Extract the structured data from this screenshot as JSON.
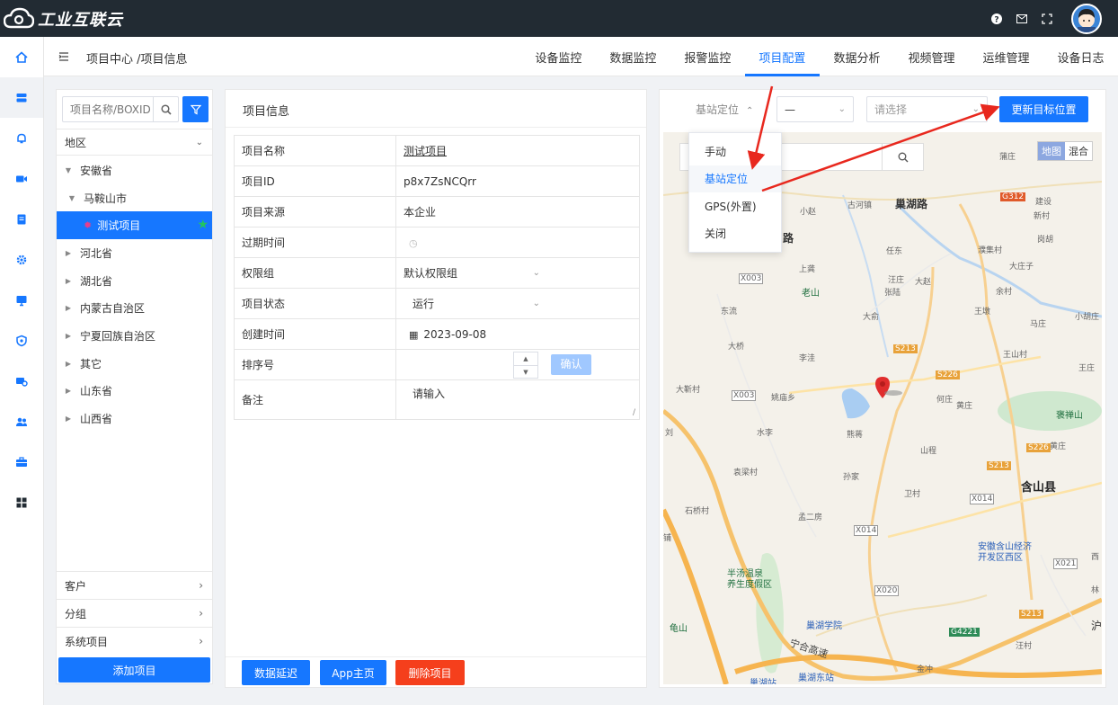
{
  "app": {
    "logo_text": "工业互联云"
  },
  "breadcrumb": "项目中心 /项目信息",
  "tabs": [
    {
      "label": "设备监控",
      "active": false
    },
    {
      "label": "数据监控",
      "active": false
    },
    {
      "label": "报警监控",
      "active": false
    },
    {
      "label": "项目配置",
      "active": true
    },
    {
      "label": "数据分析",
      "active": false
    },
    {
      "label": "视频管理",
      "active": false
    },
    {
      "label": "运维管理",
      "active": false
    },
    {
      "label": "设备日志",
      "active": false
    }
  ],
  "left": {
    "search_placeholder": "项目名称/BOXID",
    "region_label": "地区",
    "tree": [
      {
        "label": "安徽省",
        "level": 0,
        "expanded": true
      },
      {
        "label": "马鞍山市",
        "level": 1,
        "expanded": true
      },
      {
        "label": "测试项目",
        "level": 2,
        "active": true
      },
      {
        "label": "河北省",
        "level": 0
      },
      {
        "label": "湖北省",
        "level": 0
      },
      {
        "label": "内蒙古自治区",
        "level": 0
      },
      {
        "label": "宁夏回族自治区",
        "level": 0
      },
      {
        "label": "其它",
        "level": 0
      },
      {
        "label": "山东省",
        "level": 0
      },
      {
        "label": "山西省",
        "level": 0
      }
    ],
    "accordions": [
      "客户",
      "分组",
      "系统项目"
    ],
    "add_button": "添加项目"
  },
  "info": {
    "title": "项目信息",
    "rows": {
      "name_label": "项目名称",
      "name_value": "测试项目",
      "id_label": "项目ID",
      "id_value": "p8x7ZsNCQrr",
      "source_label": "项目来源",
      "source_value": "本企业",
      "expire_label": "过期时间",
      "perm_label": "权限组",
      "perm_value": "默认权限组",
      "status_label": "项目状态",
      "status_value": "运行",
      "created_label": "创建时间",
      "created_value": "2023-09-08",
      "sort_label": "排序号",
      "confirm": "确认",
      "remark_label": "备注",
      "remark_placeholder": "请输入"
    },
    "buttons": {
      "delay": "数据延迟",
      "app_home": "App主页",
      "delete": "删除项目"
    }
  },
  "map_panel": {
    "locate_mode": "基站定位",
    "select1": "—",
    "select2_placeholder": "请选择",
    "update_button": "更新目标位置",
    "toggle": {
      "map": "地图",
      "hybrid": "混合"
    },
    "dropdown": [
      {
        "label": "手动",
        "active": false
      },
      {
        "label": "基站定位",
        "active": true
      },
      {
        "label": "GPS(外置)",
        "active": false
      },
      {
        "label": "关闭",
        "active": false
      }
    ]
  },
  "map_labels": {
    "chaohu_road": "巢湖路",
    "road_frag": "路",
    "hanshan": "含山县",
    "laoshan": "老山",
    "taoshan": "褒禅山",
    "bantang": "半汤温泉",
    "bantang2": "养生度假区",
    "chaohu_college": "巢湖学院",
    "chaohu_east": "巢湖东站",
    "chaohu_station": "巢湖站",
    "kaifa": "安徽含山经济",
    "kaifa2": "开发区西区",
    "guishan": "龟山",
    "ninghe": "宁合高速",
    "guhe": "古河镇",
    "xiaozhao": "小赵",
    "renzhuang": "任东",
    "shangzhuang": "上龚",
    "dachen": "大俞",
    "wangqiao": "王墩",
    "daqiao": "大桥",
    "dongliu": "东流",
    "lizhuang": "李洼",
    "yaomiao": "姚庙乡",
    "dahuan": "大靳村",
    "shuili": "水李",
    "xiongjian": "熊蒋",
    "shancheng": "山程",
    "sunjia": "孙家",
    "weicun": "卫村",
    "yuan": "袁梁村",
    "shijiao": "石桥村",
    "mengerfang": "孟二房",
    "huangzhuang": "黄庄",
    "huangzhuang2": "黄庄",
    "hezhuang": "何庄",
    "wangshan": "王山村",
    "wangzhuang": "王庄",
    "yucun": "余村",
    "dakou": "大庄子",
    "machuang": "马庄",
    "xiaohu": "小胡庄",
    "jianshe": "建设",
    "xincun": "新村",
    "gangyu": "岗胡",
    "liji": "濮集村",
    "wangzhuang3": "汪庄",
    "zhangxian": "张陆",
    "dazhao": "大赵",
    "puzhuang": "蒲庄",
    "wangcun": "汪村",
    "jinchong": "金冲",
    "liu": "刘",
    "r_g312": "G312",
    "r_x003": "X003",
    "r_x003b": "X003",
    "r_s213": "S213",
    "r_s226": "S226",
    "r_s213b": "S213",
    "r_x014": "X014",
    "r_x014b": "X014",
    "r_x020": "X020",
    "r_x021": "X021",
    "r_g4221": "G4221",
    "r_s213c": "S213",
    "r_s226b": "S226",
    "hu": "沪",
    "lin": "林",
    "xi": "西",
    "jiaozhen": "铺"
  }
}
